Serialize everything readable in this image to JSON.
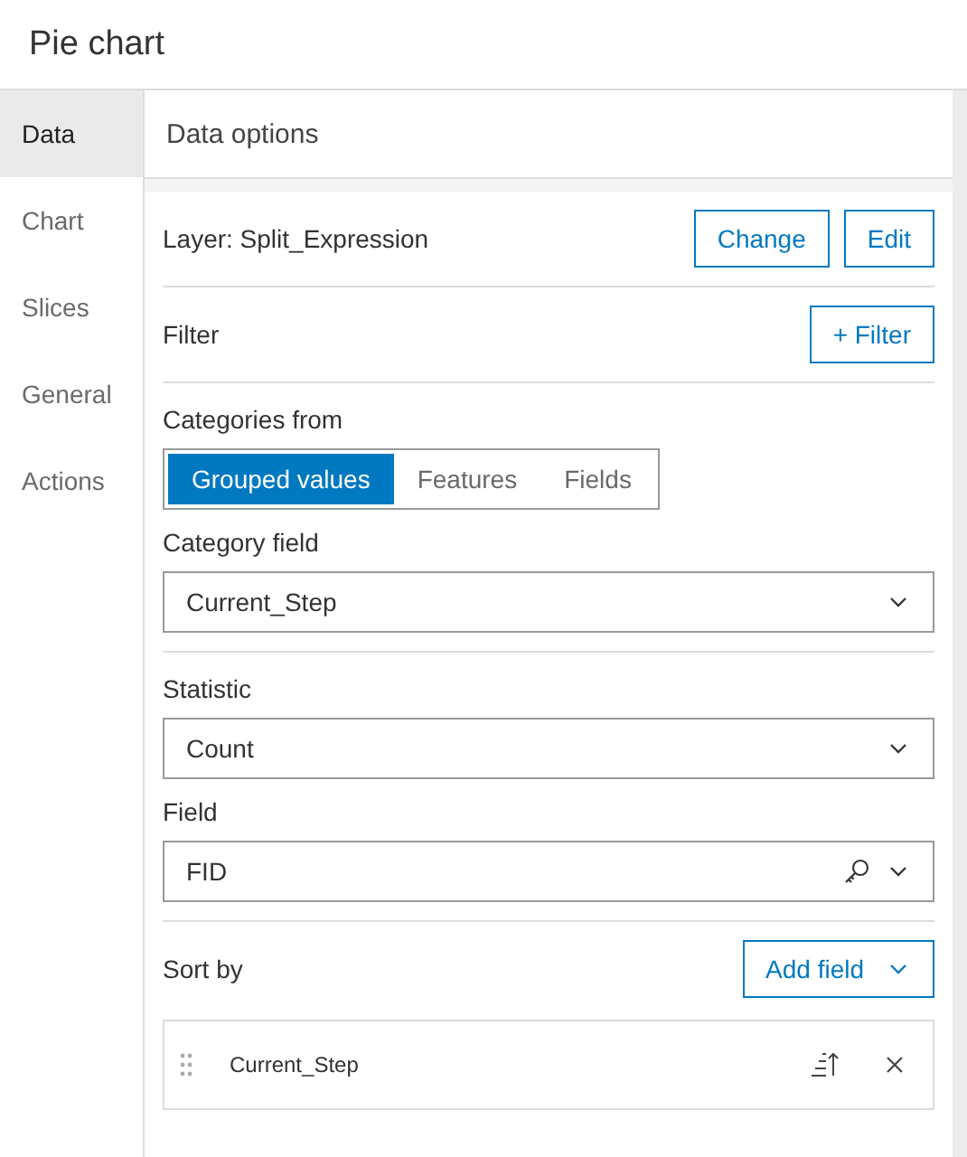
{
  "title": "Pie chart",
  "tabs": [
    {
      "label": "Data",
      "selected": true
    },
    {
      "label": "Chart",
      "selected": false
    },
    {
      "label": "Slices",
      "selected": false
    },
    {
      "label": "General",
      "selected": false
    },
    {
      "label": "Actions",
      "selected": false
    }
  ],
  "panel_title": "Data options",
  "layer": {
    "label": "Layer: Split_Expression",
    "buttons": [
      "Change",
      "Edit"
    ]
  },
  "filter": {
    "label": "Filter",
    "button": "+ Filter"
  },
  "categories": {
    "label": "Categories from",
    "options": [
      {
        "label": "Grouped values",
        "selected": true
      },
      {
        "label": "Features",
        "selected": false
      },
      {
        "label": "Fields",
        "selected": false
      }
    ]
  },
  "category_field": {
    "label": "Category field",
    "value": "Current_Step"
  },
  "statistic": {
    "label": "Statistic",
    "value": "Count"
  },
  "field": {
    "label": "Field",
    "value": "FID"
  },
  "sort": {
    "label": "Sort by",
    "button": "Add field",
    "items": [
      {
        "name": "Current_Step"
      }
    ]
  }
}
